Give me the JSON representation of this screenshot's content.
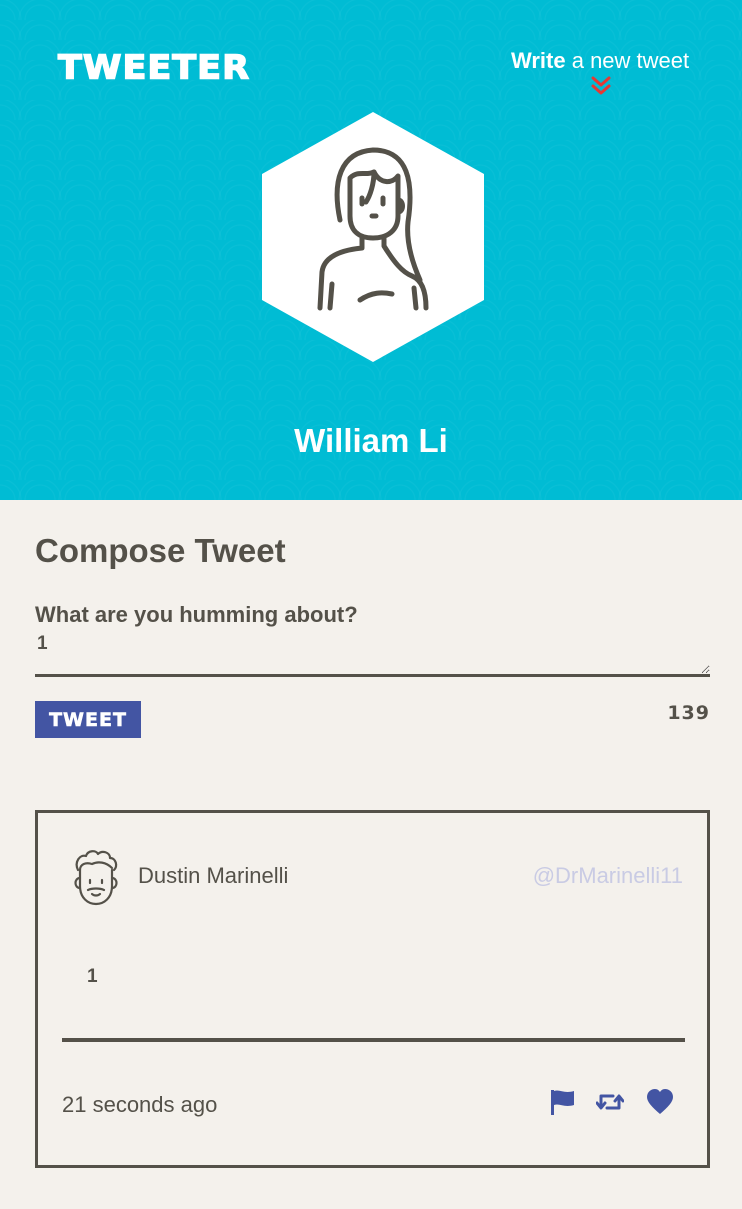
{
  "header": {
    "logo": "TWEETER",
    "write_bold": "Write",
    "write_rest": " a new tweet",
    "chevron_icon": "double-chevron-down-icon",
    "user_name": "William Li",
    "avatar_icon": "woman-avatar-icon"
  },
  "compose": {
    "title": "Compose Tweet",
    "label": "What are you humming about?",
    "text_value": "1",
    "button_label": "TWEET",
    "counter": "139"
  },
  "tweet": {
    "author": "Dustin Marinelli",
    "handle": "@DrMarinelli11",
    "body": "1",
    "time": "21 seconds ago",
    "avatar_icon": "man-avatar-icon",
    "actions": [
      "flag-icon",
      "retweet-icon",
      "heart-icon"
    ]
  },
  "colors": {
    "header_bg": "#00bcd4",
    "page_bg": "#f4f1ec",
    "text": "#545149",
    "accent": "#4355a3",
    "chevron": "#e53935",
    "handle": "#c9cbe4"
  }
}
